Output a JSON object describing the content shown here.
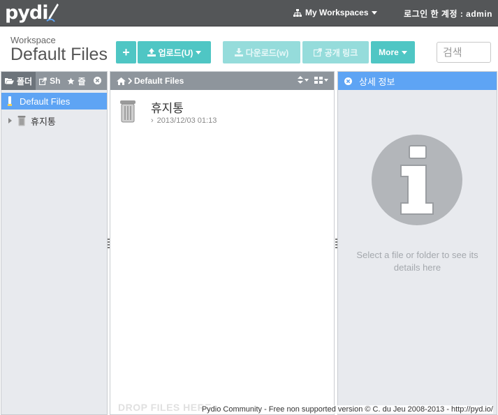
{
  "app": {
    "logo_text": "pydi",
    "workspaces_label": "My Workspaces",
    "user_label": "로그인 한 계정 : admin"
  },
  "header": {
    "workspace_label": "Workspace",
    "title": "Default Files"
  },
  "toolbar": {
    "add_label": "+",
    "upload_label": "업로드(U)",
    "download_label": "다운로드(w)",
    "share_label": "공개 링크",
    "more_label": "More"
  },
  "search": {
    "placeholder": "검색"
  },
  "left_pane": {
    "tabs": [
      {
        "label": "폴더",
        "icon": "folder-open-icon"
      },
      {
        "label": "Sh",
        "icon": "share-icon"
      },
      {
        "label": "즐",
        "icon": "star-icon"
      }
    ],
    "tree": [
      {
        "label": "Default Files",
        "icon": "workspace-icon",
        "selected": true
      },
      {
        "label": "휴지통",
        "icon": "trash-icon",
        "selected": false
      }
    ]
  },
  "center_pane": {
    "breadcrumb": "Default Files",
    "items": [
      {
        "name": "휴지통",
        "date": "2013/12/03 01:13",
        "icon": "trash-icon"
      }
    ],
    "drop_hint": "DROP FILES HERE"
  },
  "right_pane": {
    "title": "상세 정보",
    "empty_message": "Select a file or folder to see its details here"
  },
  "footer": {
    "text": "Pydio Community - Free non supported version © C. du Jeu 2008-2013 - http://pyd.io/"
  },
  "colors": {
    "topbar": "#545658",
    "accent_teal": "#4fc6c4",
    "selection_blue": "#5ea4f4",
    "pane_header_gray": "#8e959c",
    "pane_background": "#e8eaee"
  }
}
